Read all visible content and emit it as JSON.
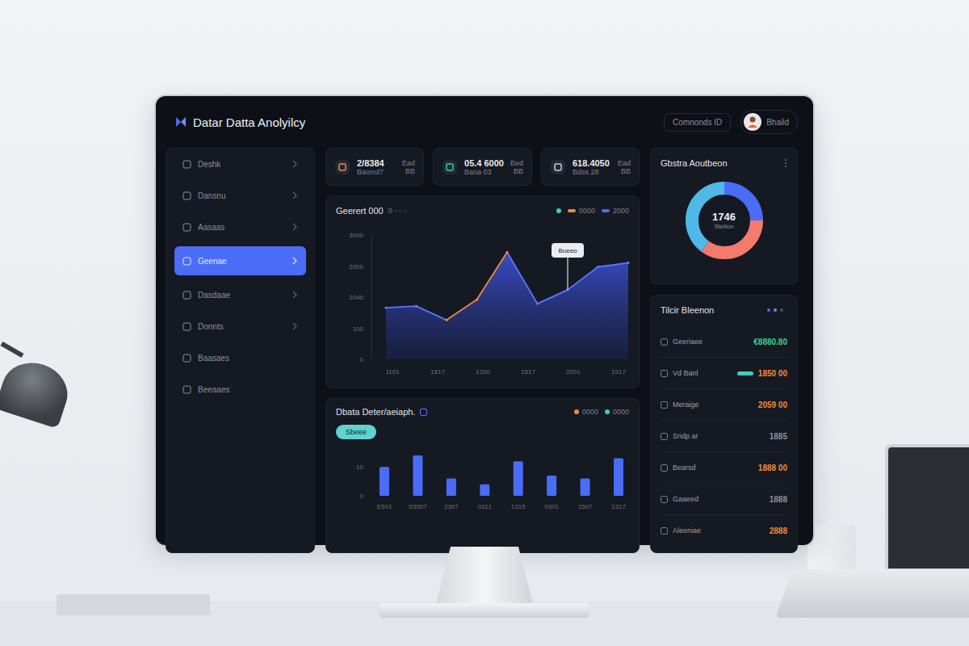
{
  "app": {
    "title": "Datar Datta Anolyilcy"
  },
  "header": {
    "command": "Comnonds ID",
    "user": "Bhaild"
  },
  "sidebar": {
    "items": [
      {
        "label": "Deshk",
        "selected": false,
        "expandable": true
      },
      {
        "label": "Dansnu",
        "selected": false,
        "expandable": true
      },
      {
        "label": "Aasaas",
        "selected": false,
        "expandable": true
      },
      {
        "label": "Geenae",
        "selected": true,
        "expandable": true
      },
      {
        "label": "Dasdaae",
        "selected": false,
        "expandable": true
      },
      {
        "label": "Donnts",
        "selected": false,
        "expandable": true
      },
      {
        "label": "Baasaes",
        "selected": false,
        "expandable": false
      },
      {
        "label": "Beeaaes",
        "selected": false,
        "expandable": false
      }
    ]
  },
  "stats": [
    {
      "value": "2/8384",
      "sub": "Baonol7",
      "side": "Ead",
      "side_sub": "BB",
      "color": "#f08a3c"
    },
    {
      "value": "05.4 6000",
      "sub": "Baoa 03",
      "side": "Bed",
      "side_sub": "BB",
      "color": "#3ccf8e"
    },
    {
      "value": "618.4050",
      "sub": "Bdss 28",
      "side": "Ead",
      "side_sub": "BB",
      "color": "#c9ced8"
    }
  ],
  "area_chart": {
    "title": "Geerert 000",
    "subtitle": "0 ◦ ◦ ◦",
    "legend": [
      {
        "label": "0000",
        "color": "#f08a3c"
      },
      {
        "label": "2000",
        "color": "#4a6cf7"
      }
    ],
    "y_ticks": [
      "3040",
      "2000",
      "2040",
      "100",
      "0"
    ],
    "x_ticks": [
      "1101",
      "1817",
      "1330",
      "1517",
      "2001",
      "1517"
    ],
    "max": 3040,
    "series": [
      {
        "values": [
          1260,
          1300,
          960,
          1460,
          2620,
          1360,
          1700,
          2260,
          2360
        ],
        "accent": [
          false,
          false,
          true,
          true,
          true,
          false,
          false,
          false,
          false
        ]
      }
    ],
    "tooltip": {
      "label": "Bueeo",
      "index": 6
    }
  },
  "bar_chart": {
    "title": "Dbata Deter/aeiaph.",
    "legend": [
      {
        "label": "0000",
        "color": "#f08a3c"
      },
      {
        "label": "0000",
        "color": "#3ccfc0"
      }
    ],
    "chip": "Sbeee",
    "y_ticks": [
      "10",
      "0"
    ],
    "max": 14,
    "x_ticks": [
      "E501",
      "S5507",
      "2307",
      "0311",
      "1315",
      "0301",
      "1507",
      "1317"
    ],
    "series": [
      {
        "values": [
          10,
          14,
          6,
          4,
          12,
          7,
          6,
          13
        ]
      }
    ]
  },
  "donut": {
    "title": "Gbstra Aoutbeon",
    "value": "1746",
    "label": "Stellon",
    "segments": [
      {
        "value": 25,
        "color": "#4a6cf7"
      },
      {
        "value": 35,
        "color": "#f47a6b"
      },
      {
        "value": 40,
        "color": "#4fb8e8"
      }
    ]
  },
  "list": {
    "title": "Tilcir Bleenon",
    "rows": [
      {
        "label": "Geeriaee",
        "value": "€8880.80",
        "color": "#3ccf8e",
        "kind": "plain"
      },
      {
        "label": "Vd Banl",
        "value": "1850 00",
        "color": "#f08a3c",
        "kind": "tag",
        "tag_color": "#3ccfc0"
      },
      {
        "label": "Meraige",
        "value": "2059 00",
        "color": "#f08a3c",
        "kind": "plain"
      },
      {
        "label": "Sridp ar",
        "value": "1885",
        "color": "#8a90a0",
        "kind": "plain"
      },
      {
        "label": "Bearsd",
        "value": "1888 00",
        "color": "#f08a3c",
        "kind": "plain"
      },
      {
        "label": "Gaaeed",
        "value": "1888",
        "color": "#8a90a0",
        "kind": "plain"
      },
      {
        "label": "Aleeniae",
        "value": "2888",
        "color": "#f08a3c",
        "kind": "plain"
      }
    ]
  }
}
